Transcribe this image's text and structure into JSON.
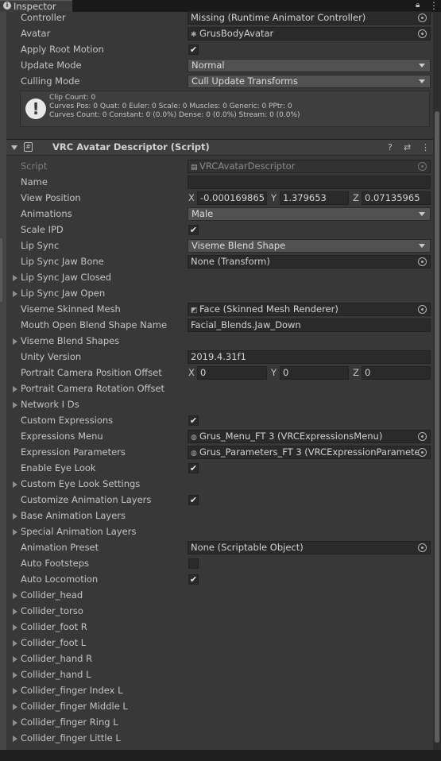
{
  "tab": {
    "title": "Inspector",
    "icon": "info-icon"
  },
  "header_icons": [
    "lock-icon",
    "more-icon"
  ],
  "animator": {
    "controller": {
      "label": "Controller",
      "value": "Missing (Runtime Animator Controller)"
    },
    "avatar": {
      "label": "Avatar",
      "value": "GrusBodyAvatar"
    },
    "apply_root_motion": {
      "label": "Apply Root Motion",
      "checked": true,
      "mark": "✔"
    },
    "update_mode": {
      "label": "Update Mode",
      "value": "Normal"
    },
    "culling_mode": {
      "label": "Culling Mode",
      "value": "Cull Update Transforms"
    },
    "info": {
      "line1": "Clip Count: 0",
      "line2": "Curves Pos: 0 Quat: 0 Euler: 0 Scale: 0 Muscles: 0 Generic: 0 PPtr: 0",
      "line3": "Curves Count: 0 Constant: 0 (0.0%) Dense: 0 (0.0%) Stream: 0 (0.0%)"
    }
  },
  "component": {
    "title": "VRC Avatar Descriptor (Script)",
    "help": "?",
    "settings": "⇄",
    "menu": "⋮",
    "script": {
      "label": "Script",
      "value": "VRCAvatarDescriptor"
    },
    "name": {
      "label": "Name",
      "value": ""
    },
    "view_position": {
      "label": "View Position",
      "x": "-0.000169865",
      "y": "1.379653",
      "z": "0.07135965",
      "x_label": "X",
      "y_label": "Y",
      "z_label": "Z"
    },
    "animations": {
      "label": "Animations",
      "value": "Male"
    },
    "scale_ipd": {
      "label": "Scale IPD",
      "checked": true
    },
    "lip_sync": {
      "label": "Lip Sync",
      "value": "Viseme Blend Shape"
    },
    "lip_sync_jaw_bone": {
      "label": "Lip Sync Jaw Bone",
      "value": "None (Transform)"
    },
    "lip_sync_jaw_closed": {
      "label": "Lip Sync Jaw Closed"
    },
    "lip_sync_jaw_open": {
      "label": "Lip Sync Jaw Open"
    },
    "viseme_skinned_mesh": {
      "label": "Viseme Skinned Mesh",
      "value": "Face (Skinned Mesh Renderer)"
    },
    "mouth_open_blend_shape": {
      "label": "Mouth Open Blend Shape Name",
      "value": "Facial_Blends.Jaw_Down"
    },
    "viseme_blend_shapes": {
      "label": "Viseme Blend Shapes"
    },
    "unity_version": {
      "label": "Unity Version",
      "value": "2019.4.31f1"
    },
    "portrait_cam_pos": {
      "label": "Portrait Camera Position Offset",
      "x": "0",
      "y": "0",
      "z": "0"
    },
    "portrait_cam_rot": {
      "label": "Portrait Camera Rotation Offset"
    },
    "network_ids": {
      "label": "Network I Ds"
    },
    "custom_expressions": {
      "label": "Custom Expressions",
      "checked": true
    },
    "expressions_menu": {
      "label": "Expressions Menu",
      "value": "Grus_Menu_FT 3 (VRCExpressionsMenu)"
    },
    "expression_parameters": {
      "label": "Expression Parameters",
      "value": "Grus_Parameters_FT 3 (VRCExpressionParamete"
    },
    "enable_eye_look": {
      "label": "Enable Eye Look",
      "checked": true
    },
    "custom_eye_look": {
      "label": "Custom Eye Look Settings"
    },
    "customize_anim_layers": {
      "label": "Customize Animation Layers",
      "checked": true
    },
    "base_anim_layers": {
      "label": "Base Animation Layers"
    },
    "special_anim_layers": {
      "label": "Special Animation Layers"
    },
    "animation_preset": {
      "label": "Animation Preset",
      "value": "None (Scriptable Object)"
    },
    "auto_footsteps": {
      "label": "Auto Footsteps",
      "checked": false
    },
    "auto_locomotion": {
      "label": "Auto Locomotion",
      "checked": true
    },
    "colliders": [
      "Collider_head",
      "Collider_torso",
      "Collider_foot R",
      "Collider_foot L",
      "Collider_hand R",
      "Collider_hand L",
      "Collider_finger Index L",
      "Collider_finger Middle L",
      "Collider_finger Ring L",
      "Collider_finger Little L"
    ]
  }
}
